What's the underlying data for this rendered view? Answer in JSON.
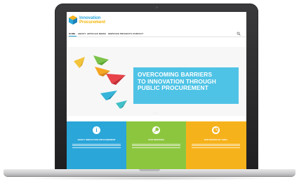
{
  "site": {
    "logo_line1": "Innovation",
    "logo_line2": "Procurement",
    "logo_icon": "hexagon-cube-icon",
    "brand_colors": {
      "blue": "#2aa6d9",
      "green": "#8cc63f",
      "yellow": "#f6b21b",
      "hero_panel": "#4fc3e6"
    }
  },
  "nav": {
    "items": [
      {
        "label": "HOME",
        "active": true
      },
      {
        "label": "ABOUT"
      },
      {
        "label": "ARTICLES"
      },
      {
        "label": "MEDIA"
      },
      {
        "label": "SERVICES"
      },
      {
        "label": "PROJECTS"
      },
      {
        "label": "CONTACT"
      }
    ],
    "search_icon": "search-icon"
  },
  "hero": {
    "title_line1": "OVERCOMING BARRIERS",
    "title_line2": "TO INNOVATION THROUGH",
    "title_line3": "PUBLIC PROCUREMENT",
    "image": "paper-airplanes"
  },
  "features": [
    {
      "title": "ABOUT INNOVATION PROCUREMENT",
      "icon": "info-icon"
    },
    {
      "title": "OUR SERVICES",
      "icon": "wrench-icon"
    },
    {
      "title": "OUR WORKS BY AREA",
      "icon": "pie-chart-icon"
    }
  ]
}
